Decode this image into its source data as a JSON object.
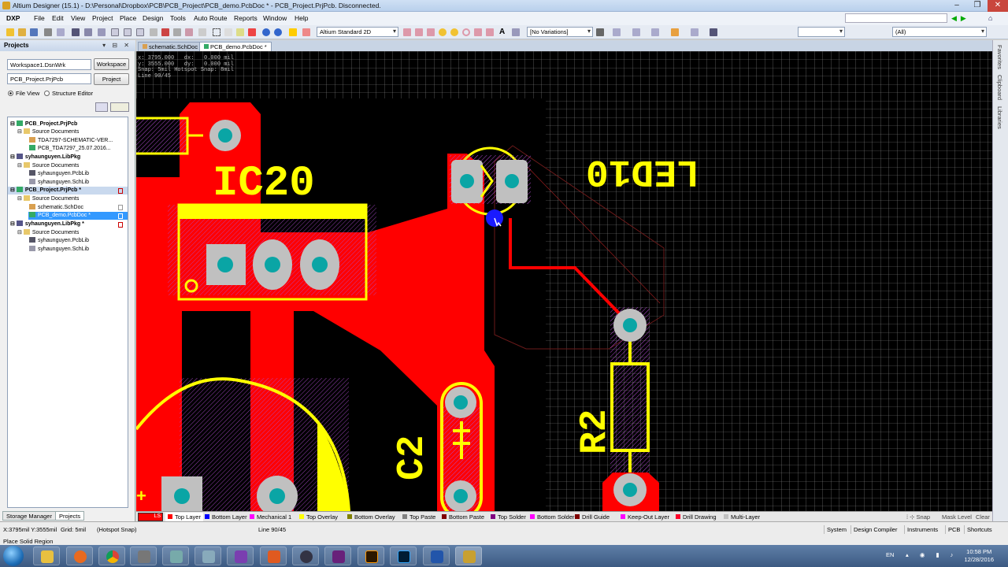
{
  "window": {
    "title": "Altium Designer (15.1) - D:\\Personal\\Dropbox\\PCB\\PCB_Project\\PCB_demo.PcbDoc * - PCB_Project.PrjPcb. Disconnected.",
    "minimize": "–",
    "maximize": "❐",
    "close": "✕"
  },
  "menu": [
    "DXP",
    "File",
    "Edit",
    "View",
    "Project",
    "Place",
    "Design",
    "Tools",
    "Auto Route",
    "Reports",
    "Window",
    "Help"
  ],
  "toolbar": {
    "view_mode": "Altium Standard 2D",
    "variations": "[No Variations]",
    "filter": "(All)"
  },
  "projects_panel": {
    "title": "Projects",
    "workspace_value": "Workspace1.DsnWrk",
    "workspace_button": "Workspace",
    "project_value": "PCB_Project.PrjPcb",
    "project_button": "Project",
    "view_options": [
      "File View",
      "Structure Editor"
    ],
    "tree": [
      {
        "label": "PCB_Project.PrjPcb",
        "level": 0,
        "bold": true
      },
      {
        "label": "Source Documents",
        "level": 1
      },
      {
        "label": "TDA7297-SCHEMATIC-VER...",
        "level": 2
      },
      {
        "label": "PCB_TDA7297_25.07.2016...",
        "level": 2
      },
      {
        "label": "syhaunguyen.LibPkg",
        "level": 0,
        "bold": true
      },
      {
        "label": "Source Documents",
        "level": 1
      },
      {
        "label": "syhaunguyen.PcbLib",
        "level": 2
      },
      {
        "label": "syhaunguyen.SchLib",
        "level": 2
      },
      {
        "label": "PCB_Project.PrjPcb *",
        "level": 0,
        "bold": true,
        "state": "active",
        "flag": true
      },
      {
        "label": "Source Documents",
        "level": 1
      },
      {
        "label": "schematic.SchDoc",
        "level": 2,
        "flag": true
      },
      {
        "label": "PCB_demo.PcbDoc *",
        "level": 2,
        "state": "selected",
        "flag": true
      },
      {
        "label": "syhaunguyen.LibPkg *",
        "level": 0,
        "bold": true,
        "flag": true
      },
      {
        "label": "Source Documents",
        "level": 1
      },
      {
        "label": "syhaunguyen.PcbLib",
        "level": 2
      },
      {
        "label": "syhaunguyen.SchLib",
        "level": 2
      }
    ],
    "bottom_tabs": [
      "Storage Manager",
      "Projects"
    ]
  },
  "doc_tabs": [
    "schematic.SchDoc",
    "PCB_demo.PcbDoc *"
  ],
  "hud": {
    "line1": "x: 3795.000   dx:   0.000 mil",
    "line2": "y: 3555.000   dy:   0.000 mil",
    "line3": "Snap: 5mil Hotspot Snap: 8mil",
    "line4": "Line 90/45"
  },
  "pcb_labels": {
    "ic": "IC20",
    "led": "LED10",
    "cap": "C2",
    "res": "R2"
  },
  "right_panels": [
    "Favorites",
    "Clipboard",
    "Libraries"
  ],
  "layers": {
    "current_box": "LS",
    "items": [
      {
        "name": "Top Layer",
        "color": "#ff0000"
      },
      {
        "name": "Bottom Layer",
        "color": "#0000ff"
      },
      {
        "name": "Mechanical 1",
        "color": "#ff00ff"
      },
      {
        "name": "Top Overlay",
        "color": "#ffff00"
      },
      {
        "name": "Bottom Overlay",
        "color": "#808000"
      },
      {
        "name": "Top Paste",
        "color": "#808080"
      },
      {
        "name": "Bottom Paste",
        "color": "#800000"
      },
      {
        "name": "Top Solder",
        "color": "#800080"
      },
      {
        "name": "Bottom Solder",
        "color": "#ff00ff"
      },
      {
        "name": "Drill Guide",
        "color": "#800000"
      },
      {
        "name": "Keep-Out Layer",
        "color": "#ff00ff"
      },
      {
        "name": "Drill Drawing",
        "color": "#ff002a"
      },
      {
        "name": "Multi-Layer",
        "color": "#c0c0c0"
      }
    ],
    "right_controls": [
      "Snap",
      "Mask Level",
      "Clear"
    ]
  },
  "status": {
    "coords": "X:3795mil Y:3555mil",
    "grid": "Grid: 5mil",
    "snap": "(Hotspot Snap)",
    "line_mode": "Line 90/45",
    "message": "Place Solid Region",
    "panels": [
      "System",
      "Design Compiler",
      "Instruments",
      "PCB",
      "Shortcuts"
    ]
  },
  "taskbar": {
    "lang": "EN",
    "time": "10:58 PM",
    "date": "12/28/2016"
  }
}
